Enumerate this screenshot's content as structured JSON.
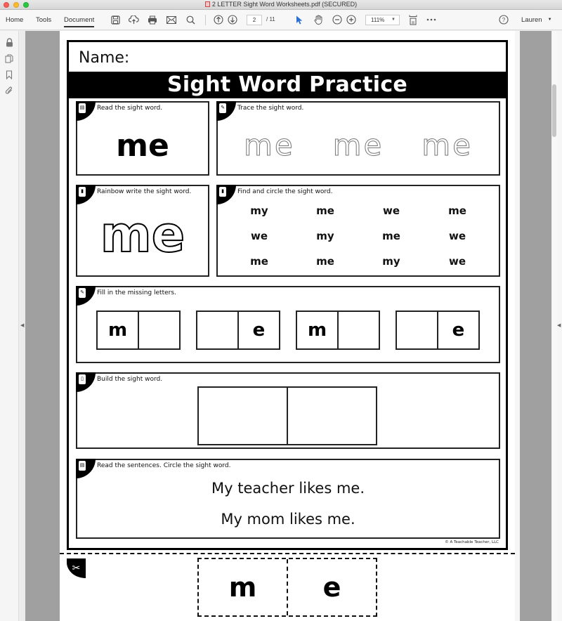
{
  "window": {
    "title": "2 LETTER Sight Word Worksheets.pdf (SECURED)"
  },
  "toolbar": {
    "tabs": [
      {
        "label": "Home"
      },
      {
        "label": "Tools"
      },
      {
        "label": "Document"
      }
    ],
    "active_tab": "Document",
    "icons": [
      "save-icon",
      "upload-cloud-icon",
      "print-icon",
      "email-icon",
      "search-icon",
      "page-up-icon",
      "page-down-icon",
      "select-arrow-icon",
      "hand-icon",
      "zoom-out-icon",
      "zoom-in-icon",
      "fit-page-icon",
      "more-icon",
      "help-icon"
    ],
    "page_current": "2",
    "page_total": "/ 11",
    "zoom_level": "111%",
    "user": "Lauren"
  },
  "sidebar": {
    "icons": [
      "lock-icon",
      "pages-icon",
      "bookmark-icon",
      "attachment-icon"
    ]
  },
  "worksheet": {
    "name_label": "Name:",
    "title": "Sight Word Practice",
    "read": {
      "instruction": "Read the sight word.",
      "word": "me"
    },
    "trace": {
      "instruction": "Trace the sight word.",
      "words": [
        "me",
        "me",
        "me"
      ]
    },
    "rainbow": {
      "instruction": "Rainbow write the sight word.",
      "word": "me"
    },
    "find": {
      "instruction": "Find and circle the sight word.",
      "words": [
        "my",
        "me",
        "we",
        "me",
        "we",
        "my",
        "me",
        "we",
        "me",
        "me",
        "my",
        "we"
      ]
    },
    "fill": {
      "instruction": "Fill in the missing letters.",
      "pairs": [
        {
          "left": "m",
          "right": ""
        },
        {
          "left": "",
          "right": "e"
        },
        {
          "left": "m",
          "right": ""
        },
        {
          "left": "",
          "right": "e"
        }
      ]
    },
    "build": {
      "instruction": "Build the sight word."
    },
    "sentences": {
      "instruction": "Read the sentences. Circle the sight word.",
      "lines": [
        "My teacher likes me.",
        "My mom likes me."
      ]
    },
    "copyright": "© A Teachable Teacher, LLC",
    "cutout_letters": [
      "m",
      "e"
    ]
  }
}
